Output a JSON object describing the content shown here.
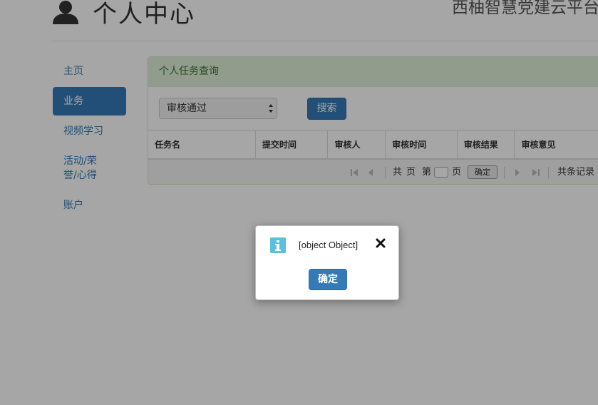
{
  "header": {
    "title": "个人中心",
    "platform": "西柚智慧党建云平台"
  },
  "sidebar": {
    "items": [
      {
        "label": "主页"
      },
      {
        "label": "业务",
        "active": true
      },
      {
        "label": "视频学习"
      },
      {
        "label": "活动/荣誉/心得"
      },
      {
        "label": "账户"
      }
    ]
  },
  "panel": {
    "heading": "个人任务查询",
    "select": {
      "selected": "审核通过"
    },
    "search_label": "搜索",
    "columns": [
      "任务名",
      "提交时间",
      "审核人",
      "审核时间",
      "审核结果",
      "审核意见"
    ]
  },
  "pager": {
    "total_prefix": "共",
    "pages_label": "页",
    "page_prefix": "第",
    "page_suffix": "页",
    "go_label": "确定",
    "records_label": "共条记录"
  },
  "dialog": {
    "message": "[object Object]",
    "confirm_label": "确定"
  },
  "colors": {
    "primary": "#337ab7",
    "panel_heading_bg": "#dff0d8",
    "panel_heading_text": "#3c763d",
    "info_icon": "#5bc0de"
  },
  "icons": {
    "user": "user-icon",
    "info": "info-icon",
    "close": "close-icon"
  }
}
